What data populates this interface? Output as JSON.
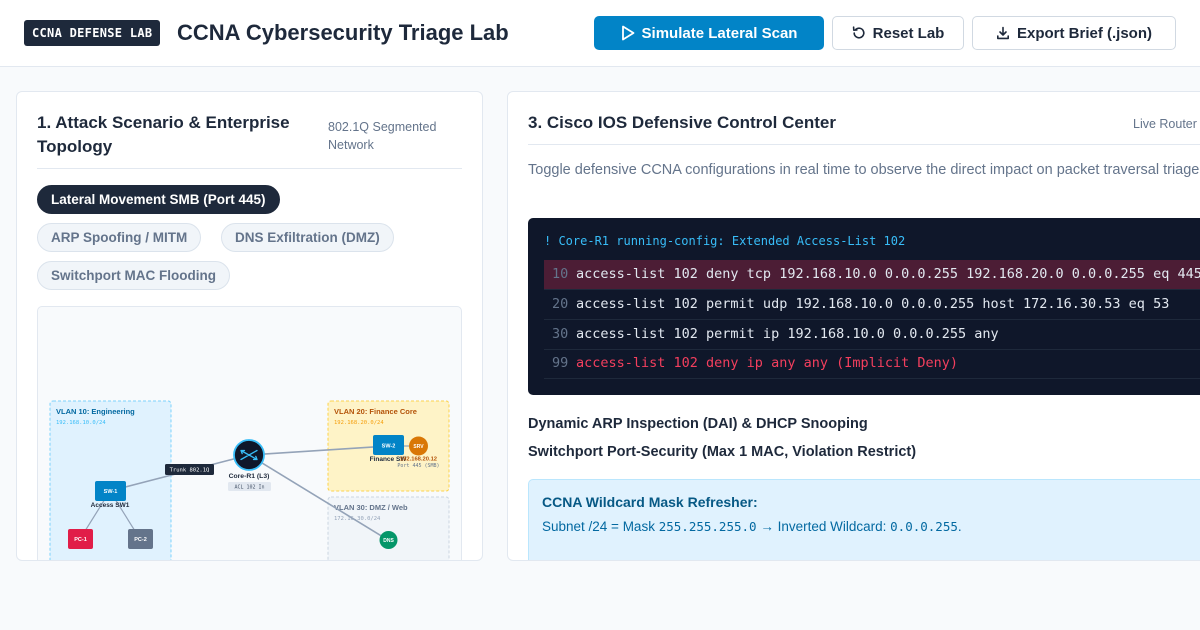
{
  "header": {
    "badge": "CCNA DEFENSE LAB",
    "title": "CCNA Cybersecurity Triage Lab",
    "simulate_label": "Simulate Lateral Scan",
    "reset_label": "Reset Lab",
    "export_label": "Export Brief (.json)"
  },
  "left_panel": {
    "title": "1. Attack Scenario & Enterprise Topology",
    "subtitle": "802.1Q Segmented Network",
    "scenarios": [
      {
        "label": "Lateral Movement SMB (Port 445)",
        "active": true
      },
      {
        "label": "ARP Spoofing / MITM",
        "active": false
      },
      {
        "label": "DNS Exfiltration (DMZ)",
        "active": false
      },
      {
        "label": "Switchport MAC Flooding",
        "active": false
      }
    ],
    "topology": {
      "vlan10": {
        "title": "VLAN 10: Engineering",
        "subnet": "192.168.10.0/24"
      },
      "vlan20": {
        "title": "VLAN 20: Finance Core",
        "subnet": "192.168.20.0/24"
      },
      "vlan30": {
        "title": "VLAN 30: DMZ / Web",
        "subnet": "172.16.30.0/24"
      },
      "trunk_label": "Trunk 802.1Q",
      "router_name": "Core-R1 (L3)",
      "router_acl": "ACL 102 In",
      "sw1_icon": "SW-1",
      "sw1_name": "Access SW1",
      "sw2_icon": "SW-2",
      "sw2_name": "Finance SW",
      "srv_icon": "SRV",
      "srv_ip": "192.168.20.12",
      "srv_port": "Port 445 (SMB)",
      "dns_icon": "DNS",
      "pc1": "PC-1",
      "pc2": "PC-2"
    }
  },
  "right_panel": {
    "title": "3. Cisco IOS Defensive Control Center",
    "subtitle": "Live Router",
    "description": "Toggle defensive CCNA configurations in real time to observe the direct impact on packet traversal triage:",
    "console_header": "! Core-R1 running-config: Extended Access-List 102",
    "acl": [
      {
        "num": "10",
        "text": "access-list 102 deny tcp 192.168.10.0 0.0.0.255 192.168.20.0 0.0.0.255 eq 445",
        "hit": true,
        "implicit": false
      },
      {
        "num": "20",
        "text": "access-list 102 permit udp 192.168.10.0 0.0.0.255 host 172.16.30.53 eq 53",
        "hit": false,
        "implicit": false
      },
      {
        "num": "30",
        "text": "access-list 102 permit ip 192.168.10.0 0.0.0.255 any",
        "hit": false,
        "implicit": false
      },
      {
        "num": "99",
        "text": "access-list 102 deny ip any any (Implicit Deny)",
        "hit": false,
        "implicit": true
      }
    ],
    "dai_label": "Dynamic ARP Inspection (DAI) & DHCP Snooping",
    "port_security_label": "Switchport Port-Security (Max 1 MAC, Violation Restrict)",
    "refresher": {
      "title": "CCNA Wildcard Mask Refresher:",
      "prefix": "Subnet /24 = Mask",
      "mask": "255.255.255.0",
      "middle": "→ Inverted Wildcard:",
      "wildcard": "0.0.0.255",
      "suffix": "."
    }
  },
  "colors": {
    "primary": "#0284c7",
    "dark": "#1e293b",
    "danger": "#f43f5e",
    "vlan10": "#0284c7",
    "vlan20": "#b45309",
    "vlan30": "#64748b"
  }
}
